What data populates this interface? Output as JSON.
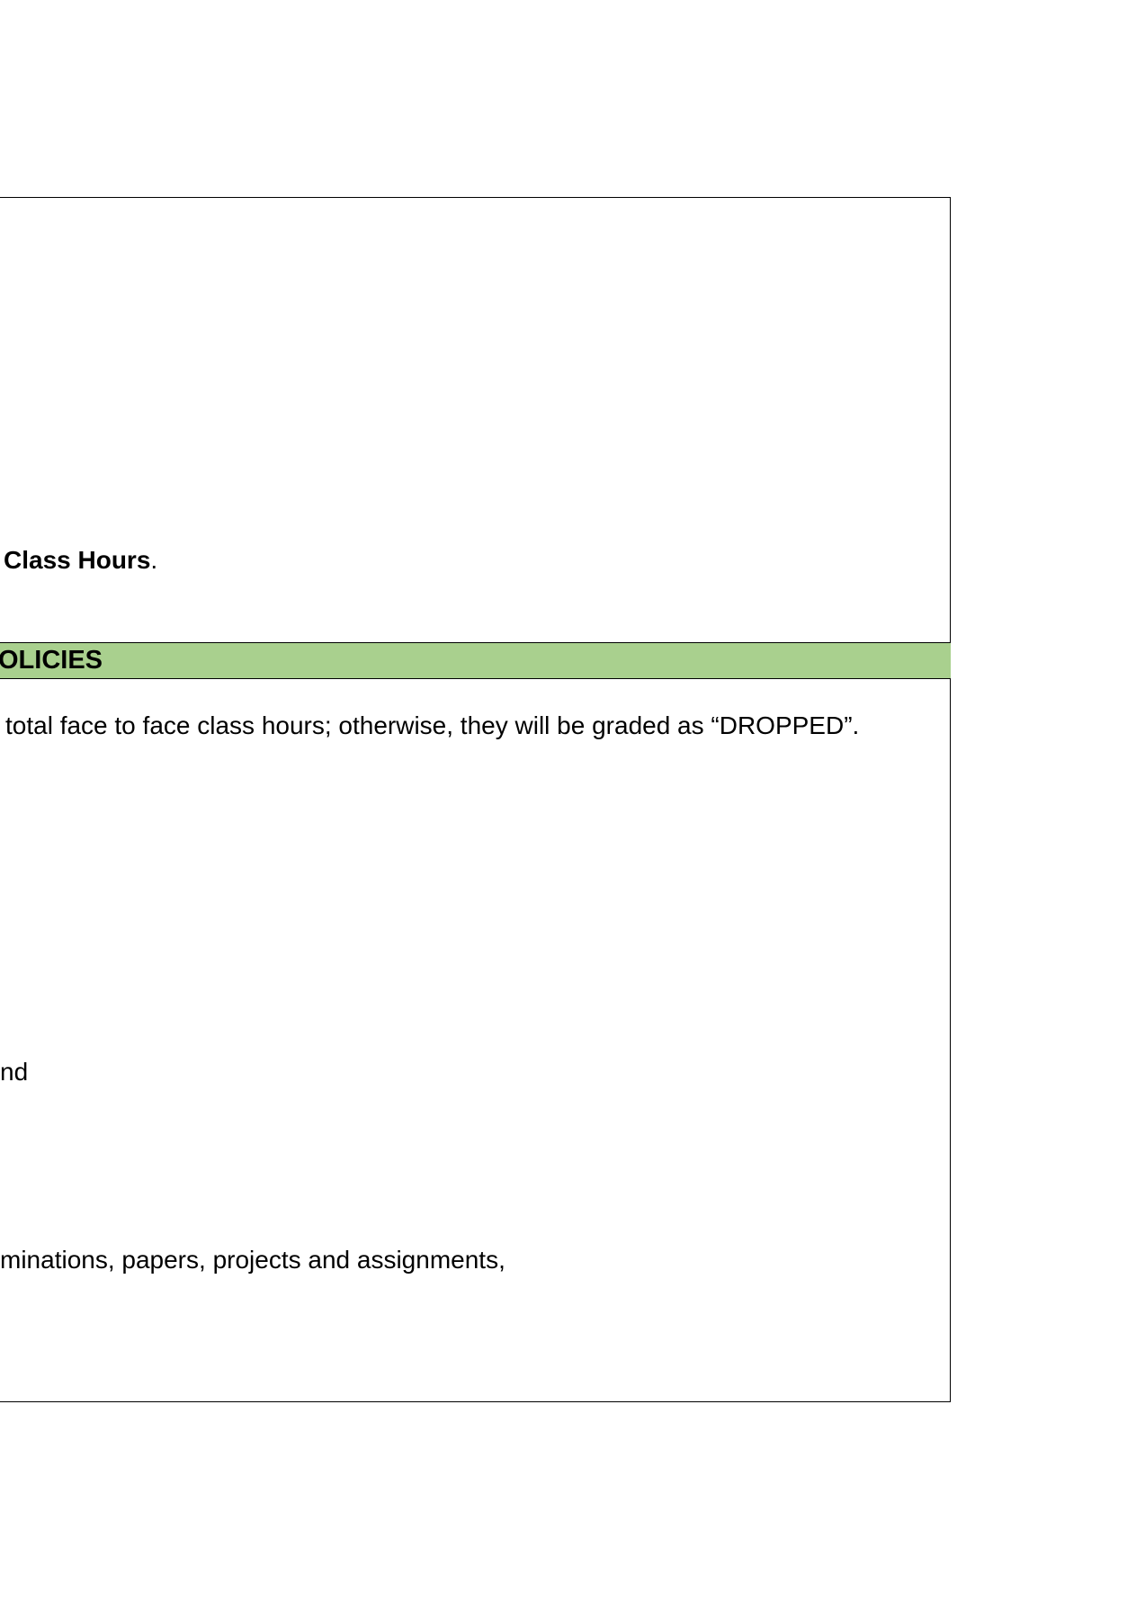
{
  "section_one": {
    "line_bold": "Class Hours",
    "line_end": "."
  },
  "policies": {
    "title": "OLICIES",
    "paragraph_1": "total face to face class hours; otherwise, they will be graded as “DROPPED”.",
    "fragment_and": "nd",
    "fragment_exams": "minations, papers, projects and assignments,"
  },
  "colors": {
    "header_fill": "#a9d08e",
    "border": "#000000"
  }
}
